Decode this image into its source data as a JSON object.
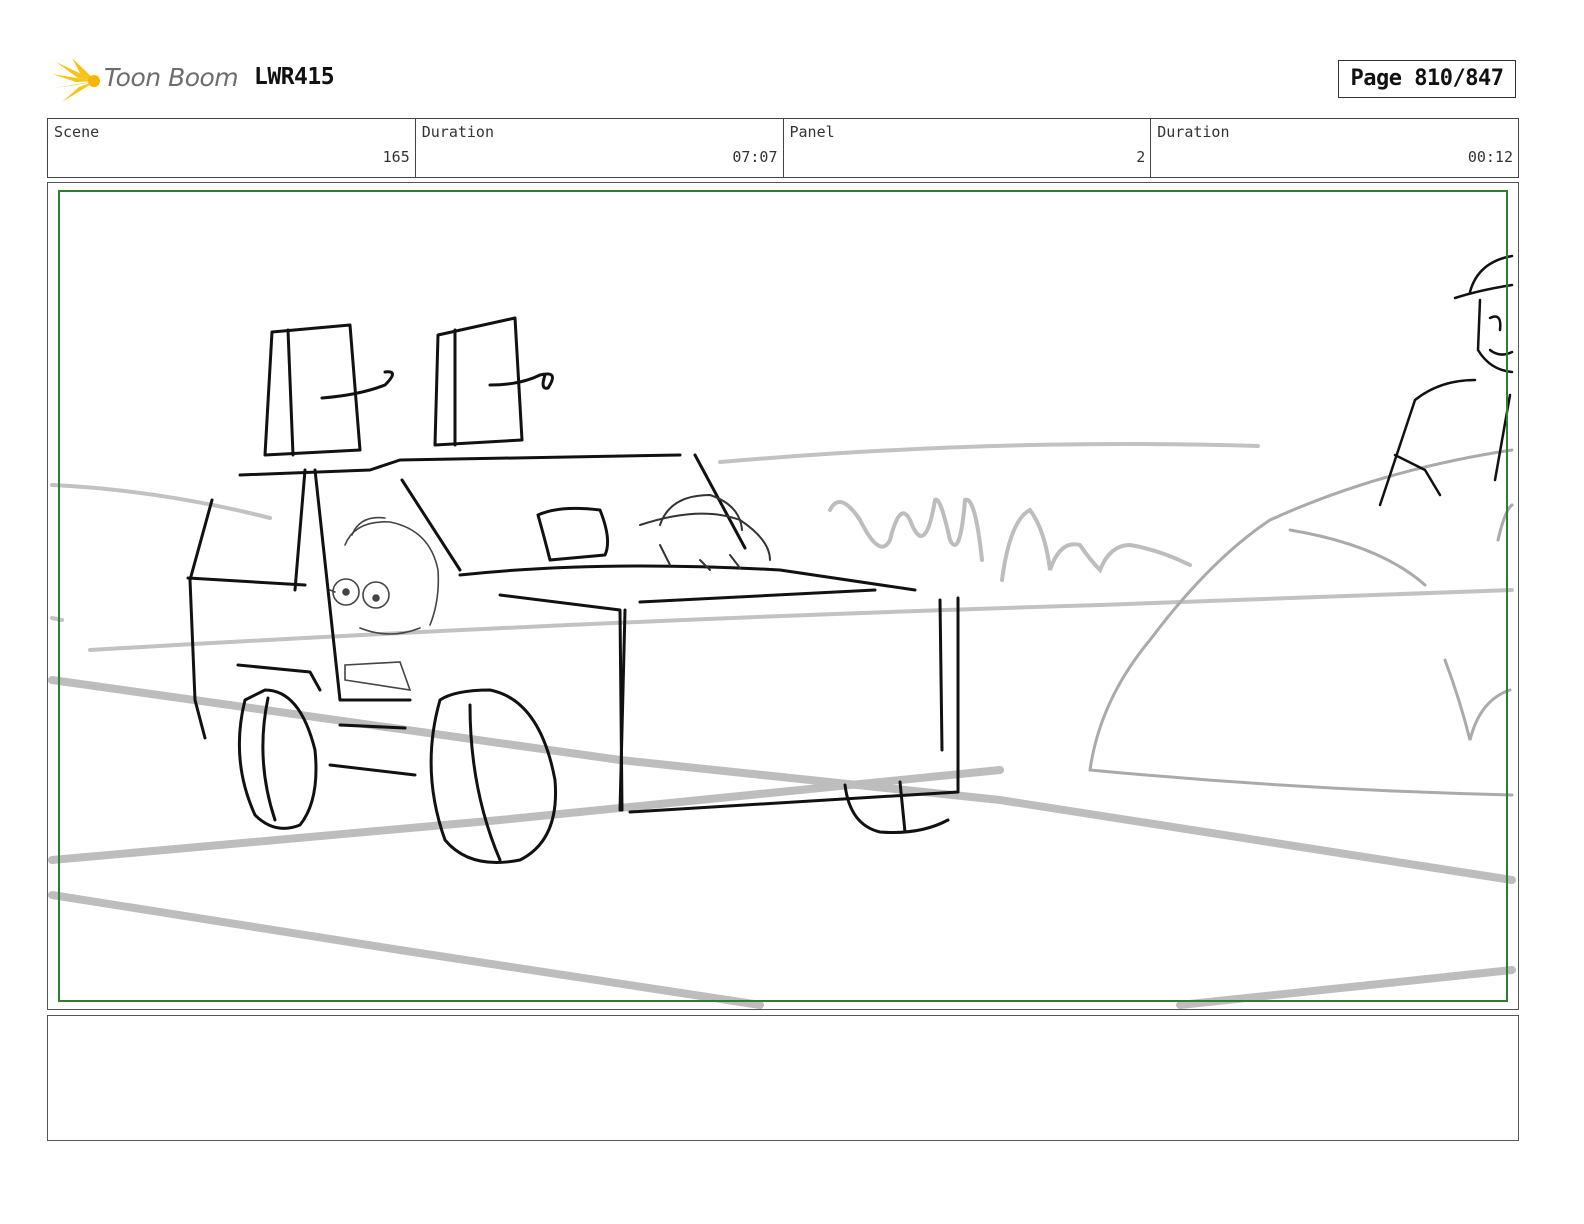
{
  "header": {
    "logo_text": "Toon Boom",
    "project_code": "LWR415",
    "page_label": "Page 810/847"
  },
  "info": {
    "scene_label": "Scene",
    "scene_value": "165",
    "scene_duration_label": "Duration",
    "scene_duration_value": "07:07",
    "panel_label": "Panel",
    "panel_value": "2",
    "panel_duration_label": "Duration",
    "panel_duration_value": "00:12"
  },
  "colors": {
    "logo_star": "#f5c518",
    "safe_area_border": "#2e7d32",
    "sketch_line": "#111111",
    "background_line": "#bdbdbd"
  },
  "notes": {
    "text": ""
  }
}
